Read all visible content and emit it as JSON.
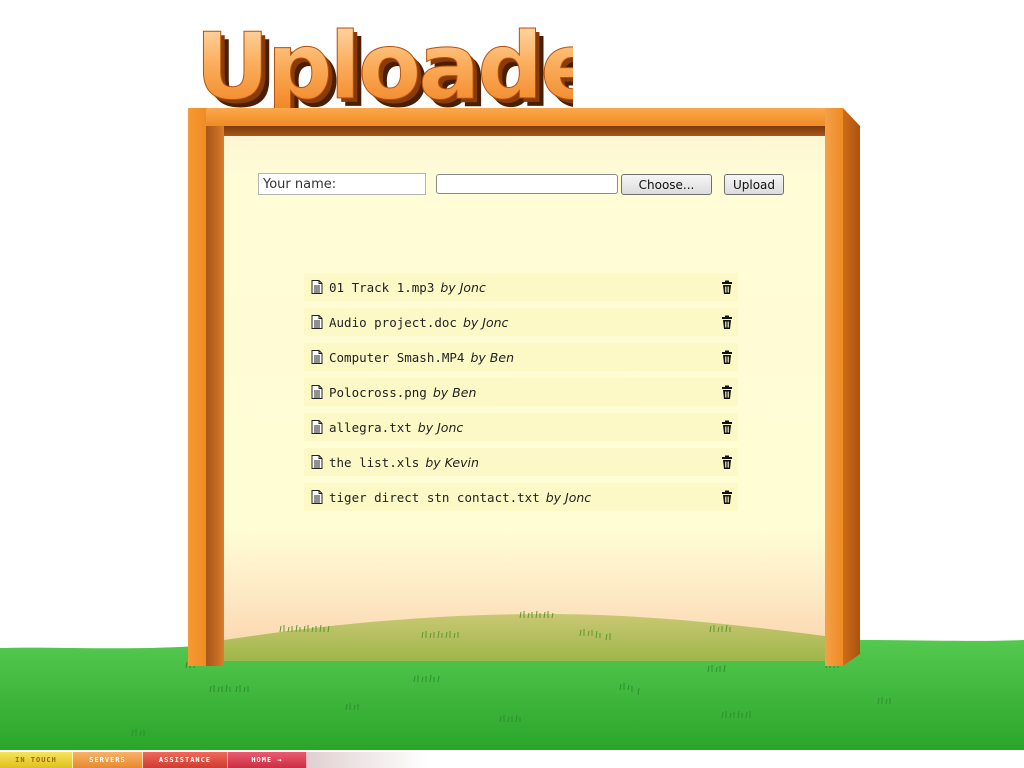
{
  "app": {
    "logo_text": "Uploader"
  },
  "form": {
    "name_placeholder": "Your name:",
    "choose_label": "Choose...",
    "upload_label": "Upload"
  },
  "files": [
    {
      "name": "01 Track 1.mp3",
      "by": "by",
      "uploader": "Jonc"
    },
    {
      "name": "Audio project.doc",
      "by": "by",
      "uploader": "Jonc"
    },
    {
      "name": "Computer Smash.MP4",
      "by": "by",
      "uploader": "Ben"
    },
    {
      "name": "Polocross.png",
      "by": "by",
      "uploader": "Ben"
    },
    {
      "name": "allegra.txt",
      "by": "by",
      "uploader": "Jonc"
    },
    {
      "name": "the list.xls",
      "by": "by",
      "uploader": "Kevin"
    },
    {
      "name": "tiger direct stn contact.txt",
      "by": "by",
      "uploader": "Jonc"
    }
  ],
  "icons": {
    "file": "document-icon",
    "delete": "trash-icon"
  },
  "nav": {
    "items": [
      {
        "label": "IN TOUCH"
      },
      {
        "label": "SERVERS"
      },
      {
        "label": "ASSISTANCE"
      },
      {
        "label": "HOME →"
      }
    ]
  },
  "colors": {
    "frame": "#f08b23",
    "panel": "#fffdd4",
    "row": "#fdf9c6",
    "grass": "#3dbb3d"
  }
}
